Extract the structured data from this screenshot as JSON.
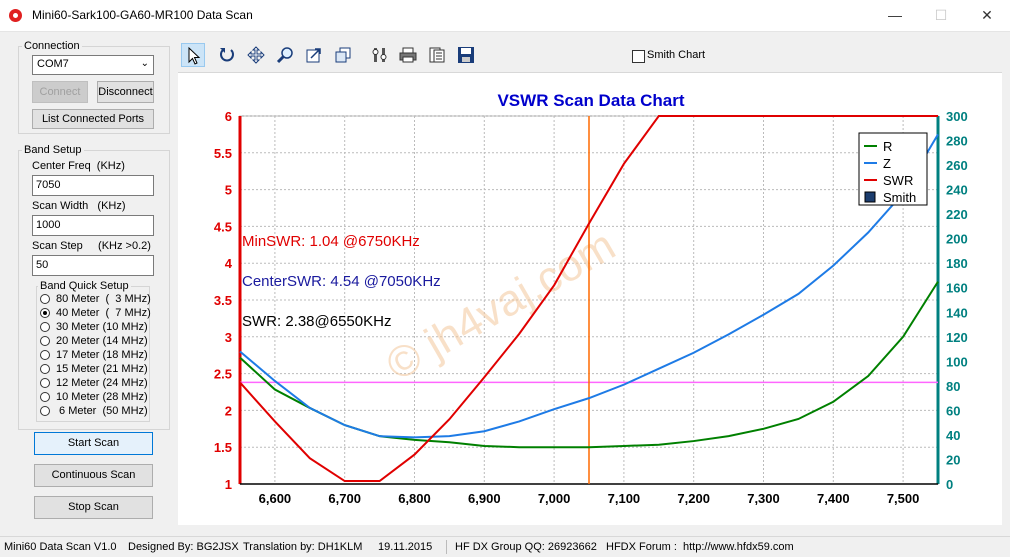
{
  "window": {
    "title": "Mini60-Sark100-GA60-MR100 Data Scan"
  },
  "connection": {
    "group_label": "Connection",
    "port_value": "COM7",
    "connect_label": "Connect",
    "disconnect_label": "Disconnect",
    "list_ports_label": "List Connected Ports"
  },
  "band_setup": {
    "group_label": "Band Setup",
    "center_freq_label": "Center Freq  (KHz)",
    "center_freq_value": "7050",
    "scan_width_label": "Scan Width   (KHz)",
    "scan_width_value": "1000",
    "scan_step_label": "Scan Step     (KHz >0.2)",
    "scan_step_value": "50",
    "quick_setup_label": "Band Quick Setup",
    "bands": [
      {
        "label": "80 Meter  (  3 MHz)",
        "selected": false
      },
      {
        "label": "40 Meter  (  7 MHz)",
        "selected": true
      },
      {
        "label": "30 Meter (10 MHz)",
        "selected": false
      },
      {
        "label": "20 Meter (14 MHz)",
        "selected": false
      },
      {
        "label": "17 Meter (18 MHz)",
        "selected": false
      },
      {
        "label": "15 Meter (21 MHz)",
        "selected": false
      },
      {
        "label": "12 Meter (24 MHz)",
        "selected": false
      },
      {
        "label": "10 Meter (28 MHz)",
        "selected": false
      },
      {
        "label": " 6 Meter  (50 MHz)",
        "selected": false
      }
    ]
  },
  "actions": {
    "start_scan": "Start Scan",
    "continuous_scan": "Continuous Scan",
    "stop_scan": "Stop Scan"
  },
  "toolbar": {
    "icons": [
      "pointer-icon",
      "rotate-icon",
      "pan-icon",
      "zoom-icon",
      "export-icon",
      "copy-icon",
      "settings-icon",
      "print-icon",
      "print-preview-icon",
      "save-icon"
    ],
    "smith_chart_label": "Smith Chart",
    "smith_chart_checked": false
  },
  "chart_data": {
    "type": "line",
    "title": "VSWR Scan Data Chart",
    "x_ticks": [
      "6,600",
      "6,700",
      "6,800",
      "6,900",
      "7,000",
      "7,100",
      "7,200",
      "7,300",
      "7,400",
      "7,500"
    ],
    "xlim": [
      6550,
      7550
    ],
    "left_axis": {
      "ylim": [
        1,
        6
      ],
      "ticks": [
        "1",
        "1.5",
        "2",
        "2.5",
        "3",
        "3.5",
        "4",
        "4.5",
        "5",
        "5.5",
        "6"
      ],
      "color": "#e00000"
    },
    "right_axis": {
      "ylim": [
        0,
        300
      ],
      "ticks": [
        "0",
        "20",
        "40",
        "60",
        "80",
        "100",
        "120",
        "140",
        "160",
        "180",
        "200",
        "220",
        "240",
        "260",
        "280",
        "300"
      ],
      "color": "#008080"
    },
    "grid": true,
    "legend_position": "top-right",
    "legend": [
      {
        "name": "R",
        "color": "#008000"
      },
      {
        "name": "Z",
        "color": "#1e7be6"
      },
      {
        "name": "SWR",
        "color": "#e00000"
      },
      {
        "name": "Smith",
        "color": "#1c3d6e"
      }
    ],
    "x": [
      6550,
      6600,
      6650,
      6700,
      6750,
      6800,
      6850,
      6900,
      6950,
      7000,
      7050,
      7100,
      7150,
      7200,
      7250,
      7300,
      7350,
      7400,
      7450,
      7500,
      7550
    ],
    "series": [
      {
        "name": "R",
        "axis": "right",
        "color": "#008000",
        "values": [
          103,
          77,
          62,
          48,
          39,
          36,
          34,
          31,
          30,
          30,
          30,
          31,
          32,
          35,
          39,
          45,
          53,
          67,
          88,
          120,
          165
        ]
      },
      {
        "name": "Z",
        "axis": "right",
        "color": "#1e7be6",
        "values": [
          108,
          84,
          62,
          48,
          39,
          38,
          39,
          43,
          51,
          61,
          70,
          81,
          94,
          107,
          122,
          138,
          155,
          178,
          205,
          237,
          285
        ]
      },
      {
        "name": "SWR",
        "axis": "left",
        "color": "#e00000",
        "values": [
          2.38,
          1.85,
          1.35,
          1.04,
          1.04,
          1.4,
          1.88,
          2.45,
          3.04,
          3.7,
          4.54,
          5.35,
          6.0,
          6.0,
          6.0,
          6.0,
          6.0,
          6.0,
          6.0,
          6.0,
          6.0
        ]
      }
    ],
    "reference_line": {
      "value": 2.38,
      "axis": "left",
      "color": "#ff66ff"
    },
    "marker_x": 7050,
    "marker_color": "#ff6a00",
    "annotations": [
      {
        "text": "MinSWR: 1.04 @6750KHz",
        "color": "#e00000"
      },
      {
        "text": "CenterSWR: 4.54 @7050KHz",
        "color": "#1a1a9e"
      },
      {
        "text": "SWR: 2.38@6550KHz",
        "color": "#000000"
      }
    ],
    "watermark": "© jh4vaj.com"
  },
  "status_bar": {
    "version": "Mini60 Data Scan V1.0",
    "designed_by": "Designed By: BG2JSX",
    "translation": "Translation by: DH1KLM",
    "date": "19.11.2015",
    "group": "HF DX Group QQ: 26923662",
    "forum": "HFDX Forum :  http://www.hfdx59.com"
  }
}
